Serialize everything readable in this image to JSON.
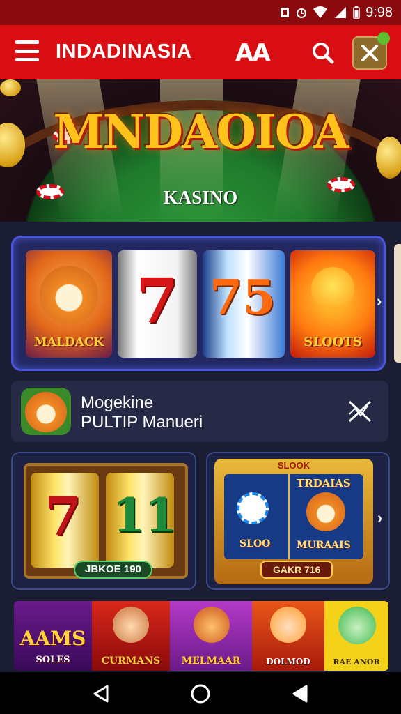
{
  "status_bar": {
    "time": "9:98"
  },
  "app_bar": {
    "title": "INDADINASIA",
    "logo_text": "AA",
    "icons": [
      "menu-icon",
      "search-icon",
      "close-icon"
    ]
  },
  "hero": {
    "title": "MNDAOIOA",
    "subtitle": "KASINO"
  },
  "slots_row": {
    "tiles": [
      {
        "label": "MALDACK"
      },
      {
        "label": "7"
      },
      {
        "label": "75"
      },
      {
        "label": "SLOOTS"
      }
    ]
  },
  "promo": {
    "line1": "Mogekine",
    "line2": "PULTIP Manueri"
  },
  "cards": {
    "card_a": {
      "reel_left": "7",
      "reel_right": "11",
      "bet_label": "JBKOE 190"
    },
    "card_b": {
      "top_label": "SLOOK",
      "left_panel": "SLOO",
      "right_title": "TRDAIAS",
      "right_panel": "MURAAIS",
      "bottom_pill": "GAKR 716"
    }
  },
  "banner": {
    "items": [
      {
        "label": "AAMS",
        "sub": "SOLES"
      },
      {
        "label": "CURMANS"
      },
      {
        "label": "MELMAAR"
      },
      {
        "label": "DOLMOD"
      },
      {
        "label": "RAE ANOR"
      }
    ]
  },
  "colors": {
    "app_bar": "#d80e12",
    "status_bar": "#8a0a0e",
    "background": "#1b1d33",
    "accent_gold": "#ffc21a"
  }
}
